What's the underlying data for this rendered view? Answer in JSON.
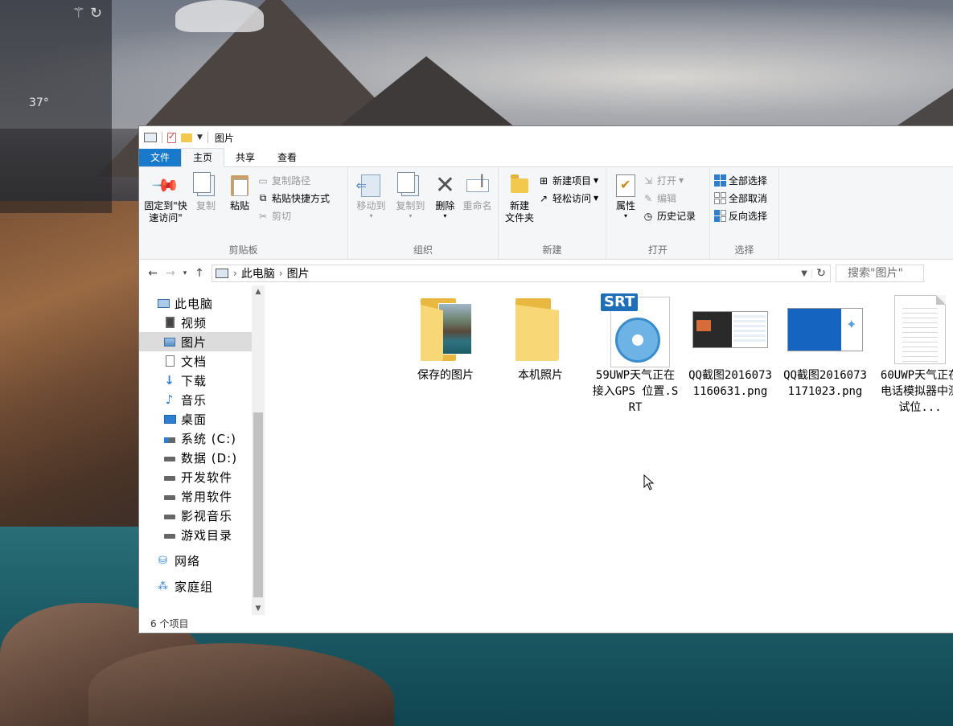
{
  "desktop": {
    "weather": {
      "temperature": "37°",
      "icons": [
        "magic-wand-icon",
        "refresh-icon"
      ]
    }
  },
  "window": {
    "title": "图片",
    "tabs": [
      "文件",
      "主页",
      "共享",
      "查看"
    ],
    "active_tab": "主页"
  },
  "ribbon": {
    "clipboard": {
      "label": "剪贴板",
      "pin": "固定到\"快\n速访问\"",
      "copy": "复制",
      "paste": "粘贴",
      "copy_path": "复制路径",
      "paste_shortcut": "粘贴快捷方式",
      "cut": "剪切"
    },
    "organize": {
      "label": "组织",
      "move_to": "移动到",
      "copy_to": "复制到",
      "delete": "删除",
      "rename": "重命名"
    },
    "new": {
      "label": "新建",
      "new_folder": "新建\n文件夹",
      "new_item": "新建项目",
      "easy_access": "轻松访问"
    },
    "open": {
      "label": "打开",
      "properties": "属性",
      "open": "打开",
      "edit": "编辑",
      "history": "历史记录"
    },
    "select": {
      "label": "选择",
      "select_all": "全部选择",
      "select_none": "全部取消",
      "invert": "反向选择"
    }
  },
  "address": {
    "crumbs": [
      "此电脑",
      "图片"
    ],
    "search_placeholder": "搜索\"图片\""
  },
  "nav": {
    "items": [
      {
        "label": "此电脑",
        "icon": "computer-icon",
        "level": 0
      },
      {
        "label": "视频",
        "icon": "video-icon",
        "level": 1
      },
      {
        "label": "图片",
        "icon": "pictures-icon",
        "level": 1,
        "selected": true
      },
      {
        "label": "文档",
        "icon": "document-icon",
        "level": 1
      },
      {
        "label": "下载",
        "icon": "download-icon",
        "level": 1
      },
      {
        "label": "音乐",
        "icon": "music-icon",
        "level": 1
      },
      {
        "label": "桌面",
        "icon": "desktop-icon",
        "level": 1
      },
      {
        "label": "系统 (C:)",
        "icon": "system-drive-icon",
        "level": 1
      },
      {
        "label": "数据 (D:)",
        "icon": "drive-icon",
        "level": 1
      },
      {
        "label": "开发软件",
        "icon": "drive-icon",
        "level": 1
      },
      {
        "label": "常用软件",
        "icon": "drive-icon",
        "level": 1
      },
      {
        "label": "影视音乐",
        "icon": "drive-icon",
        "level": 1
      },
      {
        "label": "游戏目录",
        "icon": "drive-icon",
        "level": 1
      },
      {
        "label": "网络",
        "icon": "network-icon",
        "level": 0
      },
      {
        "label": "家庭组",
        "icon": "homegroup-icon",
        "level": 0
      }
    ]
  },
  "files": [
    {
      "name": "保存的图片",
      "type": "folder-with-photo"
    },
    {
      "name": "本机照片",
      "type": "folder"
    },
    {
      "name": "59UWP天气正在接入GPS 位置.SRT",
      "type": "srt"
    },
    {
      "name": "QQ截图20160731160631.png",
      "type": "png"
    },
    {
      "name": "QQ截图20160731171023.png",
      "type": "png"
    },
    {
      "name": "60UWP天气正在电话模拟器中测试位...",
      "type": "text"
    }
  ],
  "status": {
    "item_count": "6 个项目"
  }
}
